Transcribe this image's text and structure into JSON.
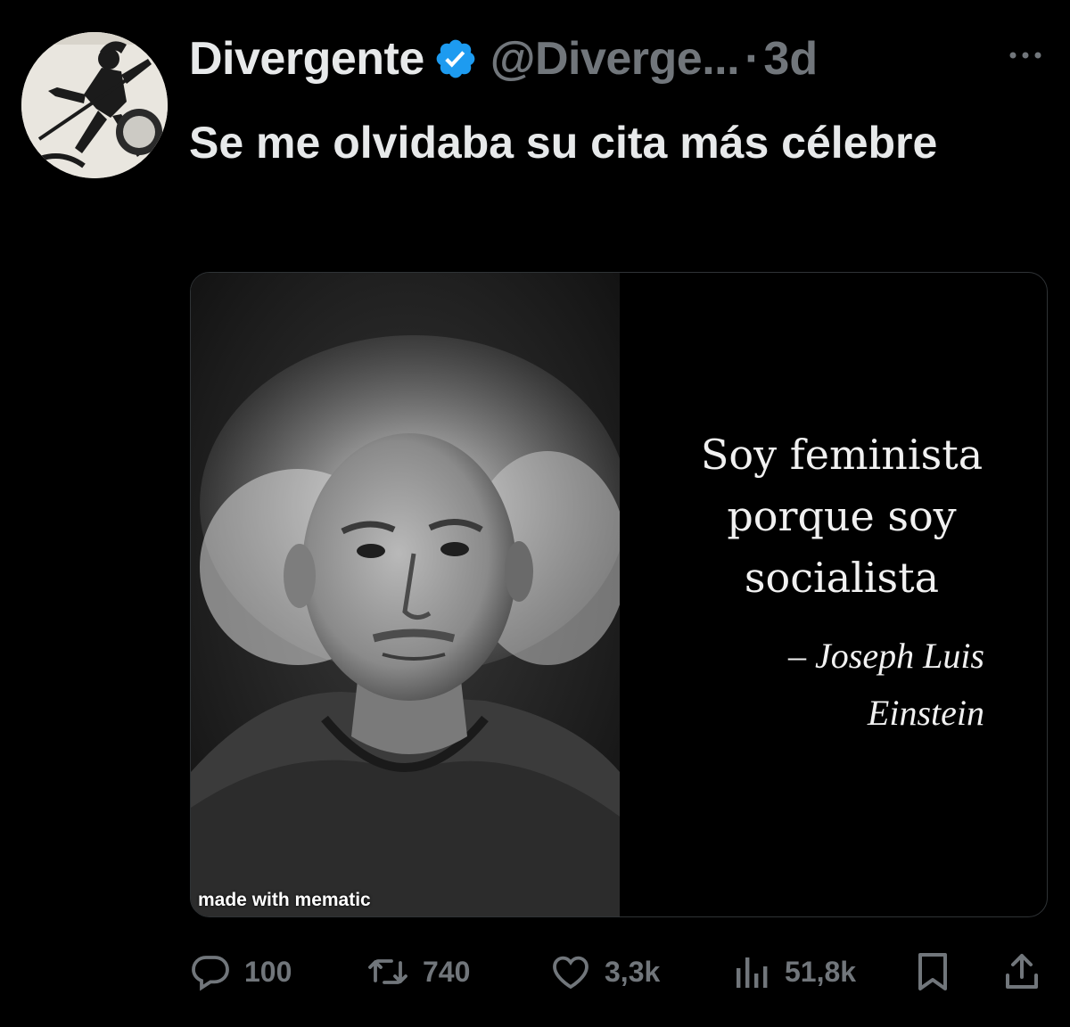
{
  "author": {
    "display_name": "Divergente",
    "handle": "@Diverge...",
    "separator": "·",
    "time": "3d"
  },
  "tweet": {
    "text": "Se me olvidaba su cita más célebre"
  },
  "media": {
    "quote": "Soy feminista porque soy socialista",
    "attribution_line1": "– Joseph Luis",
    "attribution_line2": "Einstein",
    "watermark": "made with mematic"
  },
  "actions": {
    "replies": "100",
    "retweets": "740",
    "likes": "3,3k",
    "views": "51,8k"
  },
  "icons": {
    "avatar": "avatar-greek-warrior",
    "verified": "verified-badge-icon",
    "more": "more-options-icon",
    "reply": "reply-icon",
    "retweet": "retweet-icon",
    "like": "heart-icon",
    "views": "views-chart-icon",
    "bookmark": "bookmark-icon",
    "share": "share-icon"
  },
  "colors": {
    "background": "#000000",
    "text_primary": "#e7e9ea",
    "text_secondary": "#71767b",
    "verified_blue": "#1d9bf0",
    "border": "#2f3336"
  }
}
